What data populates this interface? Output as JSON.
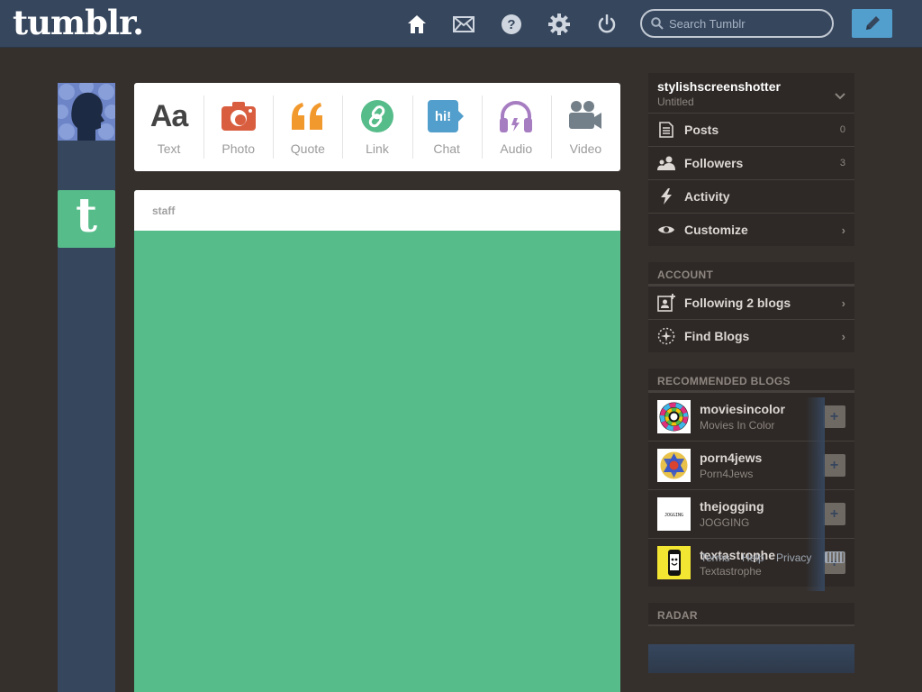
{
  "header": {
    "logo": "tumblr.",
    "nav_icons": [
      "home-icon",
      "mail-icon",
      "help-icon",
      "gear-icon",
      "power-icon"
    ],
    "search_placeholder": "Search Tumblr",
    "compose_icon": "pencil-icon",
    "colors": {
      "bar": "#36465d",
      "compose": "#529ecc"
    }
  },
  "post_types": [
    {
      "label": "Text",
      "icon": "text-icon",
      "color": "#444444"
    },
    {
      "label": "Photo",
      "icon": "camera-icon",
      "color": "#d95e40"
    },
    {
      "label": "Quote",
      "icon": "quote-icon",
      "color": "#f2992e"
    },
    {
      "label": "Link",
      "icon": "link-icon",
      "color": "#56bc8a"
    },
    {
      "label": "Chat",
      "icon": "chat-icon",
      "color": "#529ecc"
    },
    {
      "label": "Audio",
      "icon": "headphones-icon",
      "color": "#a77dc2"
    },
    {
      "label": "Video",
      "icon": "video-camera-icon",
      "color": "#748089"
    }
  ],
  "post": {
    "author": "staff",
    "avatar_letter": "t",
    "background": "#56bc8a",
    "loading": true
  },
  "sidebar": {
    "blog": {
      "name": "stylishscreenshotter",
      "title": "Untitled"
    },
    "blog_menu": [
      {
        "label": "Posts",
        "count": "0",
        "icon": "document-icon"
      },
      {
        "label": "Followers",
        "count": "3",
        "icon": "people-icon"
      },
      {
        "label": "Activity",
        "count": "",
        "icon": "lightning-icon"
      },
      {
        "label": "Customize",
        "count": "",
        "icon": "eye-icon"
      }
    ],
    "account_title": "ACCOUNT",
    "account_menu": [
      {
        "label": "Following 2 blogs",
        "icon": "add-contact-icon"
      },
      {
        "label": "Find Blogs",
        "icon": "compass-icon"
      }
    ],
    "recommended_title": "RECOMMENDED BLOGS",
    "recommended": [
      {
        "name": "moviesincolor",
        "desc": "Movies In Color",
        "avatar": "color-wheel-avatar"
      },
      {
        "name": "porn4jews",
        "desc": "Porn4Jews",
        "avatar": "star-avatar"
      },
      {
        "name": "thejogging",
        "desc": "JOGGING",
        "avatar": "jogging-avatar"
      },
      {
        "name": "textastrophe",
        "desc": "Textastrophe",
        "avatar": "phone-avatar"
      }
    ],
    "footer_links": [
      "Terms",
      "Help",
      "Privacy"
    ],
    "radar_title": "RADAR"
  }
}
